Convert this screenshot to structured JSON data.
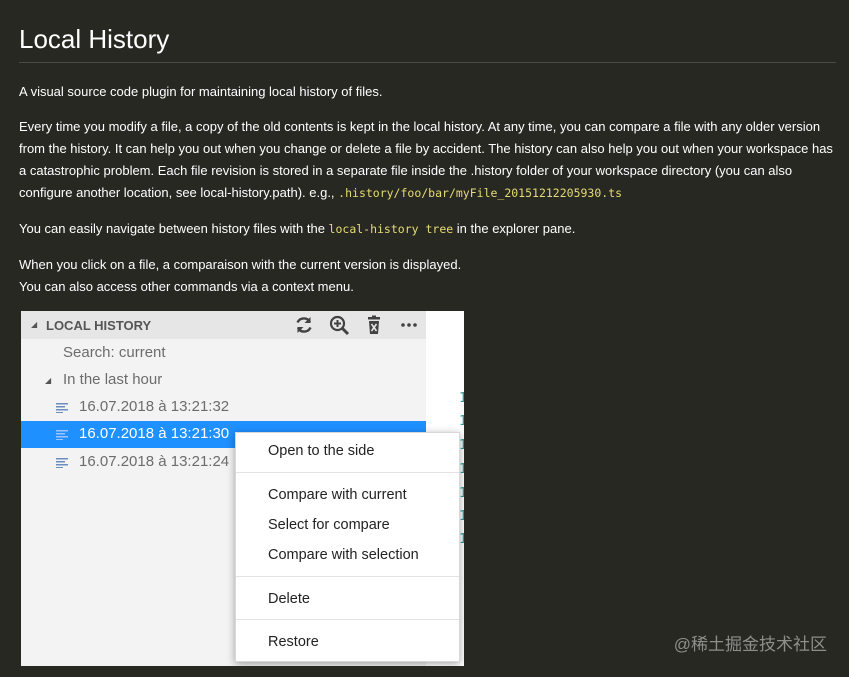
{
  "page": {
    "title": "Local History",
    "intro": "A visual source code plugin for maintaining local history of files.",
    "para2_lines": [
      "Every time you modify a file, a copy of the old contents is kept in the local history. At any time, you can compare a file with any older version",
      "from the history. It can help you out when you change or delete a file by accident. The history can also help you out when your workspace has",
      "a catastrophic problem. Each file revision is stored in a separate file inside the .history folder of your workspace directory (you can also"
    ],
    "para2_last_text": "configure another location, see local-history.path). e.g., ",
    "para2_code": ".history/foo/bar/myFile_20151212205930.ts",
    "para3_before": "You can easily navigate between history files with the ",
    "para3_code": "local-history tree",
    "para3_after": " in the explorer pane.",
    "para4_line1": "When you click on a file, a comparaison with the current version is displayed.",
    "para4_line2": "You can also access other commands via a context menu."
  },
  "panel": {
    "header_title": "LOCAL HISTORY",
    "header_icons": [
      "refresh-icon",
      "zoom-in-icon",
      "trash-icon",
      "more-icon"
    ],
    "search_label": "Search: current",
    "group_label": "In the last hour",
    "files": [
      "16.07.2018 à 13:21:32",
      "16.07.2018 à 13:21:30",
      "16.07.2018 à 13:21:24"
    ],
    "selected_index": 1,
    "gutter_digits": [
      "1",
      "1",
      "1",
      "1",
      "1",
      "1",
      "1",
      "1"
    ]
  },
  "context_menu": {
    "open_side": "Open to the side",
    "compare_current": "Compare with current",
    "select_compare": "Select for compare",
    "compare_selection": "Compare with selection",
    "delete": "Delete",
    "restore": "Restore"
  },
  "watermark": "@稀土掘金技术社区",
  "colors": {
    "background": "#272822",
    "code": "#e6db74",
    "selection": "#1e90ff"
  }
}
